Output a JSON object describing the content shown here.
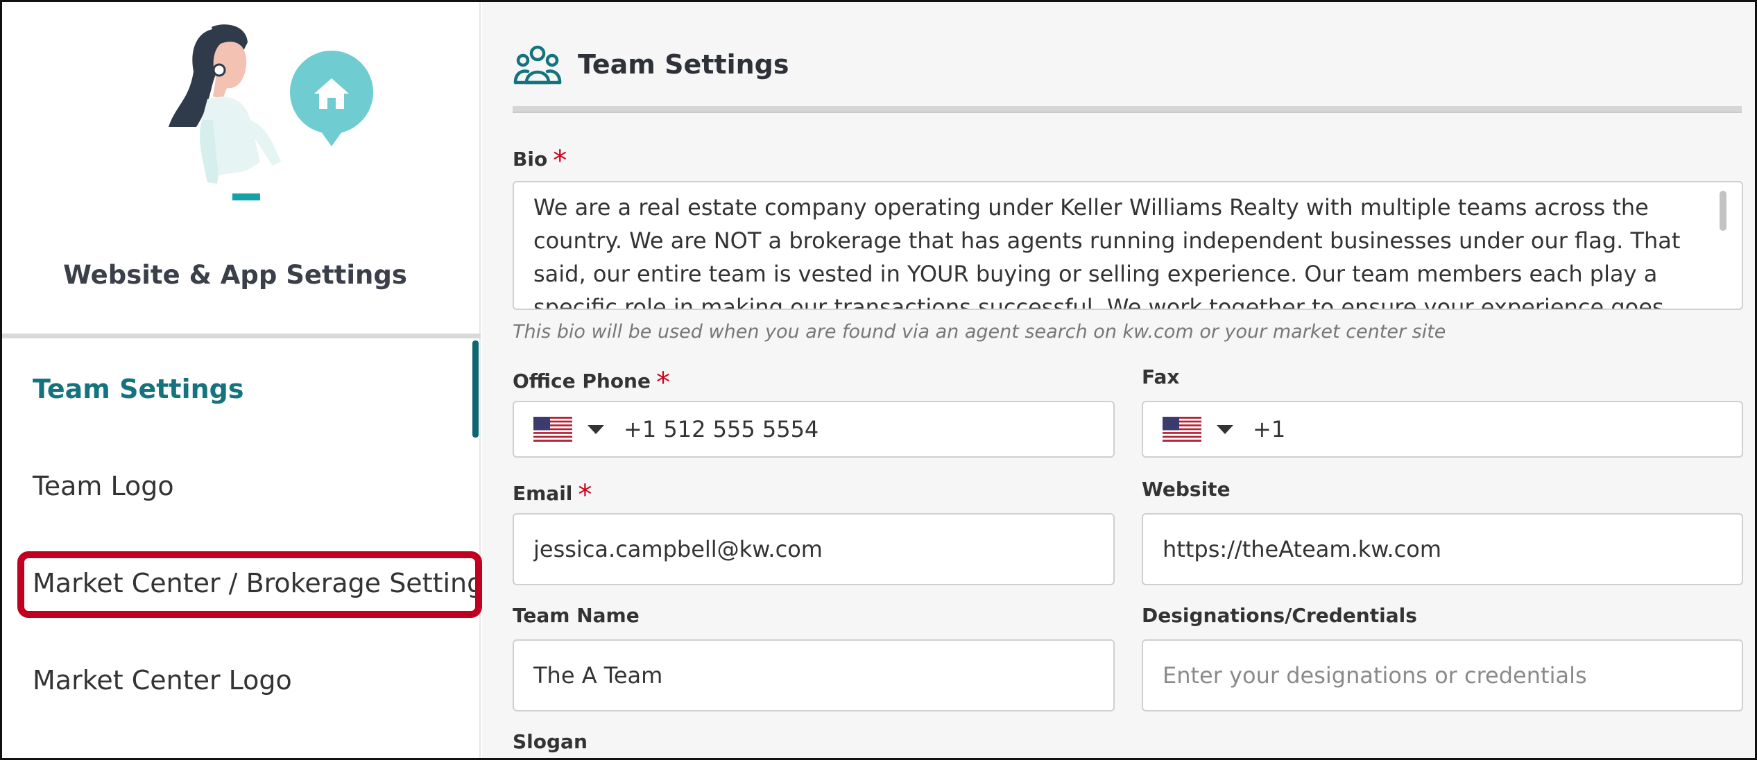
{
  "sidebar": {
    "title": "Website & App Settings",
    "items": [
      {
        "label": "Team Settings",
        "active": true
      },
      {
        "label": "Team Logo",
        "active": false
      },
      {
        "label": "Market Center / Brokerage Settings",
        "active": false,
        "highlighted": true
      },
      {
        "label": "Market Center Logo",
        "active": false
      }
    ]
  },
  "main": {
    "title": "Team Settings",
    "icon": "team-icon",
    "bio": {
      "label": "Bio",
      "required_mark": "*",
      "value": "We are a real estate company operating under Keller Williams Realty with multiple teams across the country. We are NOT a brokerage that has agents running independent businesses under our flag. That said, our entire team is vested in YOUR buying or selling experience. Our team members each play a specific role in making our transactions successful. We work together to ensure your experience goes smoothly.",
      "hint": "This bio will be used when you are found via an agent search on kw.com or your market center site"
    },
    "office_phone": {
      "label": "Office Phone",
      "required_mark": "*",
      "country": "US",
      "value": "+1 512 555 5554"
    },
    "fax": {
      "label": "Fax",
      "country": "US",
      "value": "+1"
    },
    "email": {
      "label": "Email",
      "required_mark": "*",
      "value": "jessica.campbell@kw.com"
    },
    "website": {
      "label": "Website",
      "value": "https://theAteam.kw.com"
    },
    "team_name": {
      "label": "Team Name",
      "value": "The A Team"
    },
    "designations": {
      "label": "Designations/Credentials",
      "value": "",
      "placeholder": "Enter your designations or credentials"
    },
    "slogan": {
      "label": "Slogan"
    }
  },
  "colors": {
    "accent": "#14737f",
    "highlight_border": "#c0001e",
    "required": "#d0021b"
  }
}
